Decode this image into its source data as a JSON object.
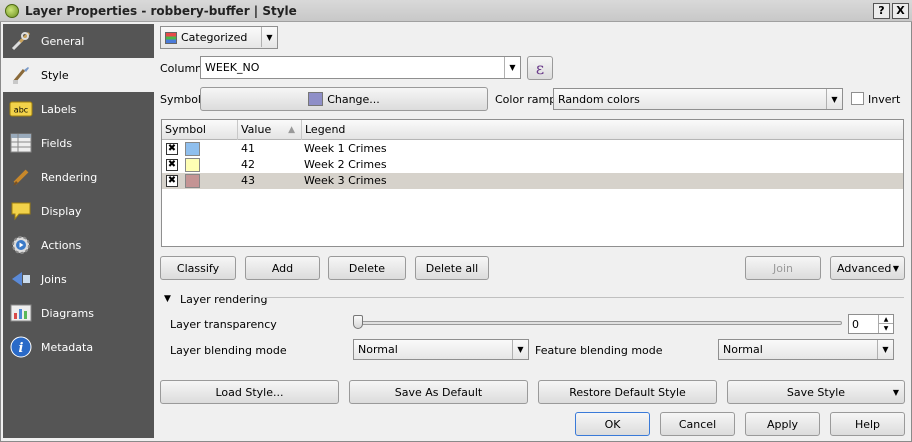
{
  "window": {
    "title": "Layer Properties - robbery-buffer | Style",
    "help_glyph": "?",
    "close_glyph": "X"
  },
  "sidebar": {
    "items": [
      {
        "label": "General",
        "icon": "wrench-icon"
      },
      {
        "label": "Style",
        "icon": "paintbrush-icon"
      },
      {
        "label": "Labels",
        "icon": "abc-label-icon"
      },
      {
        "label": "Fields",
        "icon": "table-icon"
      },
      {
        "label": "Rendering",
        "icon": "brush-icon"
      },
      {
        "label": "Display",
        "icon": "speech-bubble-icon"
      },
      {
        "label": "Actions",
        "icon": "gear-play-icon"
      },
      {
        "label": "Joins",
        "icon": "join-icon"
      },
      {
        "label": "Diagrams",
        "icon": "diagram-icon"
      },
      {
        "label": "Metadata",
        "icon": "info-icon"
      }
    ],
    "active": "Style"
  },
  "renderer": {
    "type_label": "Categorized"
  },
  "column": {
    "label": "Column",
    "value": "WEEK_NO",
    "expression_glyph": "ε"
  },
  "symbol": {
    "label": "Symbol",
    "change_label": "Change...",
    "swatch_color": "#8f8fc8"
  },
  "color_ramp": {
    "label": "Color ramp",
    "value": "Random colors",
    "invert_label": "Invert"
  },
  "table": {
    "headers": {
      "symbol": "Symbol",
      "value": "Value",
      "legend": "Legend"
    },
    "rows": [
      {
        "value": "41",
        "legend": "Week 1 Crimes",
        "color": "#8fbfee",
        "checked": true
      },
      {
        "value": "42",
        "legend": "Week 2 Crimes",
        "color": "#fefeb4",
        "checked": true
      },
      {
        "value": "43",
        "legend": "Week 3 Crimes",
        "color": "#c49494",
        "checked": true
      }
    ]
  },
  "actions": {
    "classify": "Classify",
    "add": "Add",
    "delete": "Delete",
    "delete_all": "Delete all",
    "join": "Join",
    "advanced": "Advanced"
  },
  "layer_rendering": {
    "section_label": "Layer rendering",
    "transparency_label": "Layer transparency",
    "transparency_value": "0",
    "blending_label": "Layer blending mode",
    "blending_value": "Normal",
    "feature_blending_label": "Feature blending mode",
    "feature_blending_value": "Normal"
  },
  "style_buttons": {
    "load": "Load Style...",
    "save_default": "Save As Default",
    "restore_default": "Restore Default Style",
    "save_style": "Save Style"
  },
  "dialog_buttons": {
    "ok": "OK",
    "cancel": "Cancel",
    "apply": "Apply",
    "help": "Help"
  }
}
